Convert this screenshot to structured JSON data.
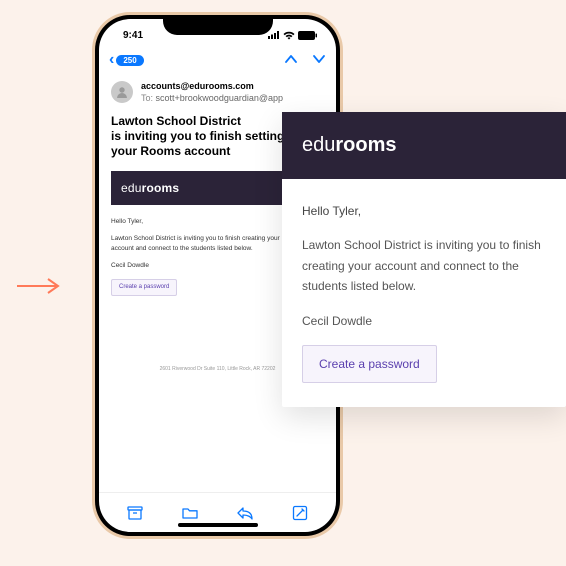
{
  "status": {
    "time": "9:41",
    "battery": "100"
  },
  "nav": {
    "badge": "250"
  },
  "email": {
    "from": "accounts@edurooms.com",
    "to_label": "To:",
    "to": "scott+brookwoodguardian@app",
    "subject_line1": "Lawton School District",
    "subject_line2": "is inviting you to finish setting",
    "subject_line3": "your Rooms account",
    "brand_edu": "edu",
    "brand_rooms": "rooms",
    "greeting": "Hello Tyler,",
    "body_small": "Lawton School District is inviting you to finish creating your Rooms account and connect to the students listed below.",
    "student": "Cecil Dowdle",
    "cta": "Create a password",
    "footer": "2601 Riverwood Dr Suite 110, Little Rock, AR 72202"
  },
  "zoom": {
    "brand_edu": "edu",
    "brand_rooms": "rooms",
    "greeting": "Hello Tyler,",
    "body": "Lawton School District is inviting you to finish creating your account and connect to the students listed below.",
    "student": "Cecil Dowdle",
    "cta": "Create a password"
  }
}
